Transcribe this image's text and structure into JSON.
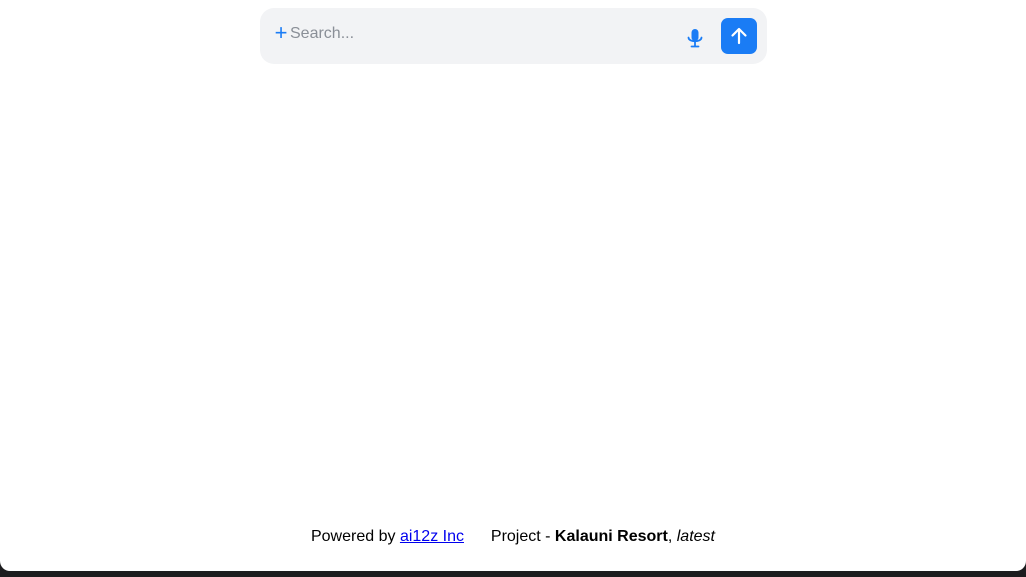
{
  "search": {
    "placeholder": "Search...",
    "value": "",
    "add_icon": "plus-icon",
    "mic_icon": "microphone-icon",
    "send_icon": "arrow-up-icon",
    "accent_color": "#1a7cf5",
    "background_color": "#f2f3f5"
  },
  "footer": {
    "powered_by_text": "Powered by",
    "company_link": "ai12z Inc",
    "project_prefix": "Project -",
    "project_name": "Kalauni Resort",
    "separator": ",",
    "version": "latest"
  }
}
